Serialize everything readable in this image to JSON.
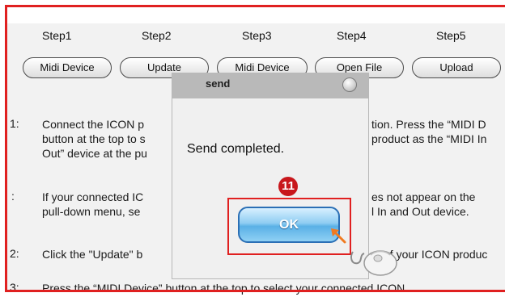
{
  "steps": [
    "Step1",
    "Step2",
    "Step3",
    "Step4",
    "Step5"
  ],
  "buttons": [
    "Midi Device",
    "Update",
    "Midi Device",
    "Open File",
    "Upload"
  ],
  "instructions": {
    "item1": {
      "number": "1:",
      "line1_left": "Connect the ICON p",
      "line1_right": "tion. Press the “MIDI D",
      "line2_left": "button at the top to s",
      "line2_right": "product as the “MIDI In",
      "line3_left": "Out” device at the pu"
    },
    "note": {
      "line1_left": "If your connected IC",
      "line1_right": "es not appear on the",
      "line2_left": "pull-down menu, se",
      "line2_right": "l In and Out device."
    },
    "item2": {
      "number": "2:",
      "line1_left": "Click the \"Update\" b",
      "line1_right": "of your ICON   produc"
    },
    "item3": {
      "number": "3:",
      "line1": "Press the “MIDI Device” button at the top to select your connected ICON"
    }
  },
  "dialog": {
    "title": "send",
    "message": "Send completed.",
    "ok_label": "OK"
  },
  "callout": {
    "number": "11"
  },
  "colors": {
    "highlight": "#e02020",
    "badge": "#c8171c",
    "ok_border": "#2b6fb5",
    "pointer": "#f07a20"
  }
}
